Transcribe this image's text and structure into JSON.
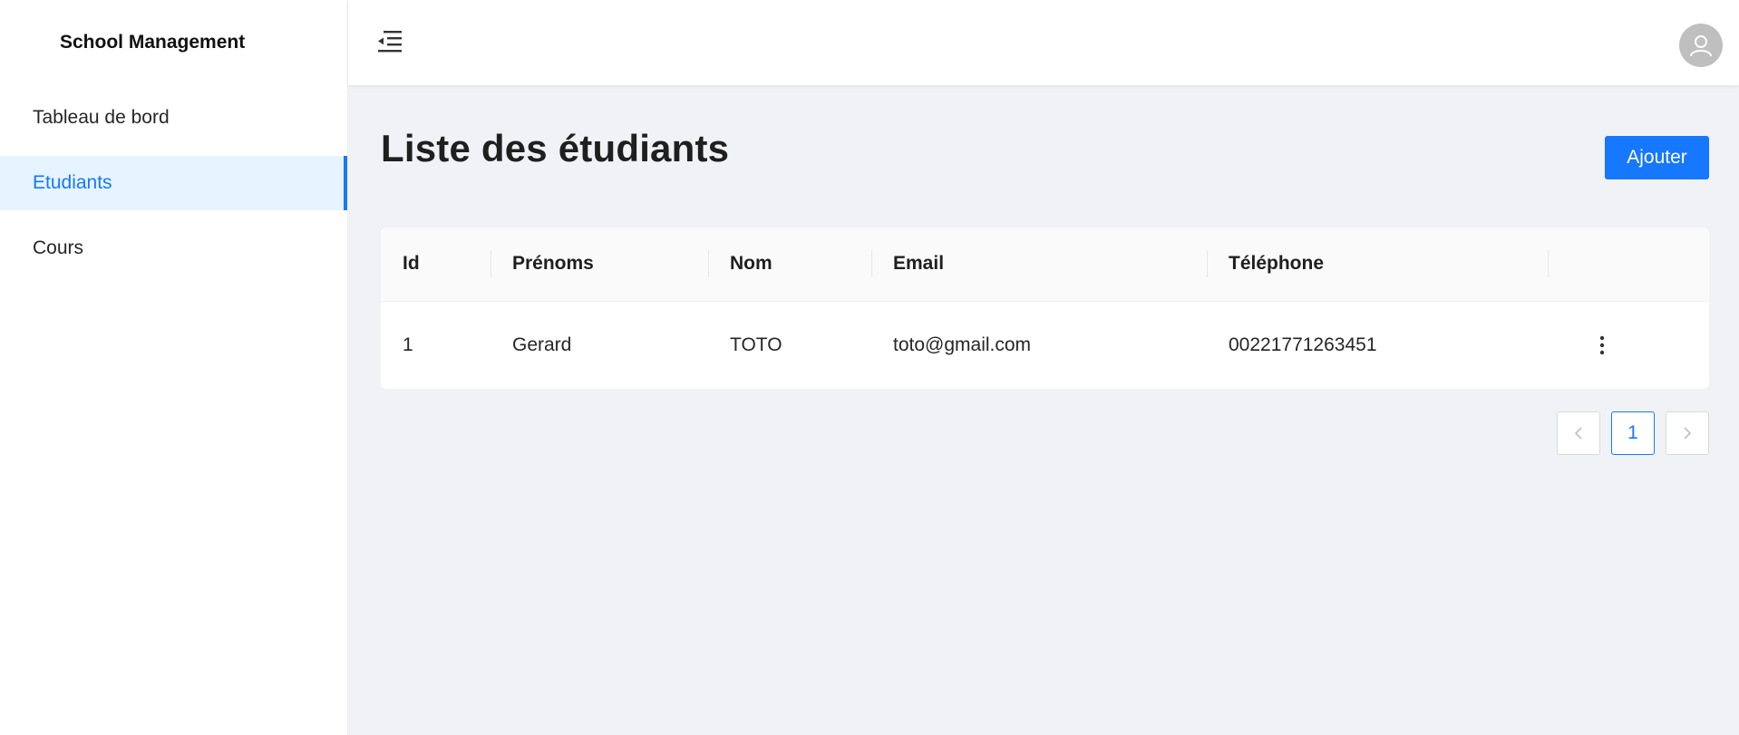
{
  "app": {
    "brand": "School Management"
  },
  "sidebar": {
    "items": [
      {
        "label": "Tableau de bord",
        "active": false
      },
      {
        "label": "Etudiants",
        "active": true
      },
      {
        "label": "Cours",
        "active": false
      }
    ]
  },
  "header": {
    "menu_toggle_icon": "menu-fold-icon",
    "avatar_icon": "user-icon"
  },
  "main": {
    "title": "Liste des étudiants",
    "add_button": "Ajouter"
  },
  "table": {
    "columns": [
      "Id",
      "Prénoms",
      "Nom",
      "Email",
      "Téléphone",
      ""
    ],
    "rows": [
      {
        "id": "1",
        "prenoms": "Gerard",
        "nom": "TOTO",
        "email": "toto@gmail.com",
        "telephone": "00221771263451"
      }
    ],
    "row_action_icon": "more-vertical-icon"
  },
  "pagination": {
    "prev_icon": "chevron-left-icon",
    "current_page": "1",
    "next_icon": "chevron-right-icon"
  },
  "colors": {
    "primary": "#1677ff",
    "active_bg": "#e6f4ff",
    "content_bg": "#f0f2f5"
  }
}
